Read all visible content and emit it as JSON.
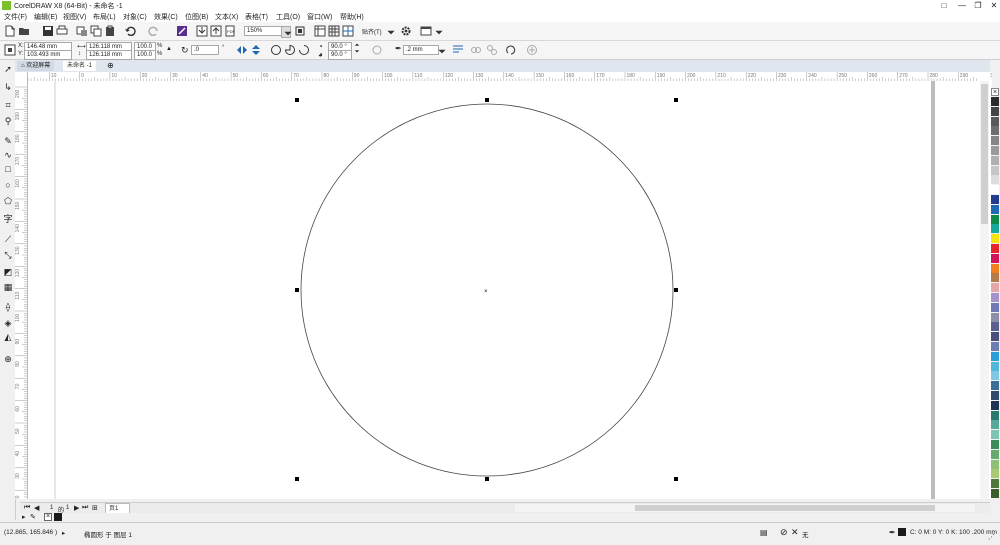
{
  "window": {
    "title": "CorelDRAW X8 (64-Bit) - 未命名 -1",
    "controls": [
      "□",
      "—",
      "❐",
      "✕"
    ]
  },
  "menu": [
    {
      "label": "文件(F)"
    },
    {
      "label": "编辑(E)"
    },
    {
      "label": "视图(V)"
    },
    {
      "label": "布局(L)"
    },
    {
      "label": "对象(C)"
    },
    {
      "label": "效果(C)"
    },
    {
      "label": "位图(B)"
    },
    {
      "label": "文本(X)"
    },
    {
      "label": "表格(T)"
    },
    {
      "label": "工具(O)"
    },
    {
      "label": "窗口(W)"
    },
    {
      "label": "帮助(H)"
    }
  ],
  "toolbar": {
    "zoom": "150%",
    "snap_label": "贴齐(T)"
  },
  "properties": {
    "x_label": "X:",
    "x_value": "146.48 mm",
    "y_label": "Y:",
    "y_value": "103.493 mm",
    "width": "126.118 mm",
    "height": "126.118 mm",
    "scale_x": "100.0",
    "scale_y": "100.0",
    "percent": "%",
    "rotation": ".0",
    "rotation_unit": "°",
    "angle_start": "90.0 °",
    "angle_end": "90.0 °",
    "outline_width": ".2 mm"
  },
  "tabs": [
    {
      "label": "欢迎屏幕"
    },
    {
      "label": "未命名 -1"
    }
  ],
  "ruler": {
    "h_labels": [
      "20",
      "10",
      "0",
      "10",
      "20",
      "30",
      "40",
      "50",
      "60",
      "70",
      "80",
      "90",
      "100",
      "110",
      "120",
      "130",
      "140",
      "150",
      "160",
      "170",
      "180",
      "190",
      "200",
      "210",
      "220",
      "230",
      "240",
      "250",
      "260",
      "270",
      "280",
      "290",
      "300"
    ],
    "v_labels": [
      "200",
      "190",
      "180",
      "170",
      "160",
      "150",
      "140",
      "130",
      "120",
      "110",
      "100",
      "90",
      "80",
      "70",
      "60",
      "50",
      "40",
      "30",
      "20",
      "10"
    ]
  },
  "pages": {
    "current": "1",
    "separator": "的",
    "total": "1",
    "page_tab": "页1"
  },
  "status": {
    "coords": "(12.865, 165.846 )",
    "arrow": "▸",
    "object_info": "椭圆形 于 图层 1",
    "fill_label": "无",
    "outline_info": "C: 0 M: 0 Y: 0 K: 100  .200 mm"
  },
  "palette_colors": [
    "#2b2b2b",
    "#444444",
    "#5a5a5a",
    "#6e6e6e",
    "#858585",
    "#9a9a9a",
    "#b0b0b0",
    "#c6c6c6",
    "#dcdcdc",
    "#ffffff",
    "#233a8e",
    "#1f68b2",
    "#0f8a4a",
    "#19a89d",
    "#f5e20e",
    "#e6262a",
    "#d4145a",
    "#f07f1f",
    "#b37c4a",
    "#e4a7a7",
    "#a493c8",
    "#6e79b6",
    "#8c8fa8",
    "#5a5f92",
    "#4a4e7c",
    "#6d7fb1",
    "#2b9fd8",
    "#51b6d8",
    "#7fc7e2",
    "#3c6f95",
    "#2e4a6d",
    "#1d3352",
    "#2b7a6f",
    "#57a79a",
    "#7ec4b4",
    "#3d8c5c",
    "#66aa70",
    "#8ec07a",
    "#a8c873",
    "#4d7a3c",
    "#3a5e2e"
  ],
  "icons": {
    "tools": [
      "pick-tool-icon",
      "shape-tool-icon",
      "crop-tool-icon",
      "zoom-tool-icon",
      "freehand-tool-icon",
      "artistic-media-icon",
      "rectangle-tool-icon",
      "ellipse-tool-icon",
      "polygon-tool-icon",
      "text-tool-icon",
      "parallel-dimension-icon",
      "connector-tool-icon",
      "drop-shadow-icon",
      "transparency-icon",
      "eyedropper-icon",
      "interactive-fill-icon",
      "smart-fill-icon",
      "add-tool-icon"
    ]
  }
}
